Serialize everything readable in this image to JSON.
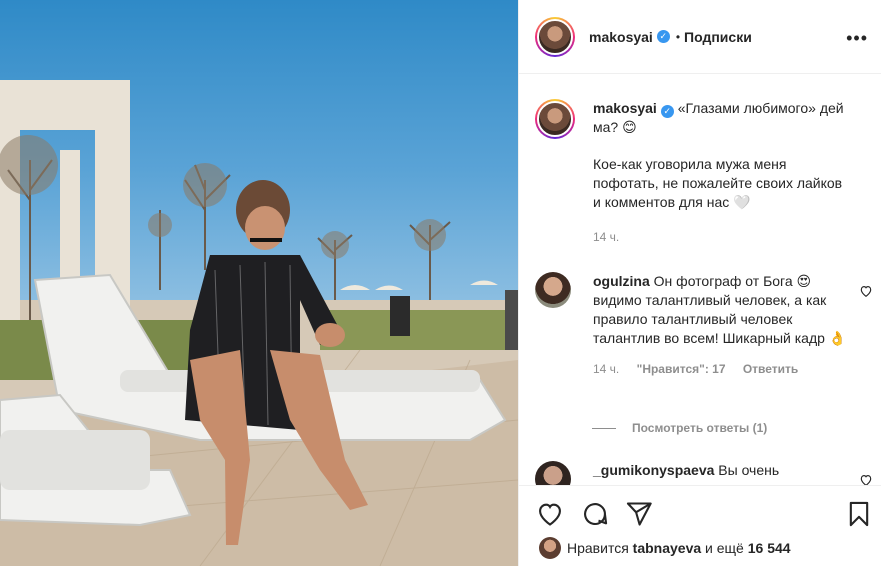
{
  "post": {
    "author": "makosyai",
    "verified_glyph": "✓",
    "follow_separator": "•",
    "follow_label": "Подписки",
    "more_icon": "•••"
  },
  "caption": {
    "author": "makosyai",
    "line1": "«Глазами любимого» дей ма? 😊",
    "line2": "Кое-как уговорила мужа меня пофотать, не пожалейте своих лайков и комментов для нас 🤍",
    "time": "14 ч."
  },
  "comments": [
    {
      "author": "ogulzina",
      "text": "Он фотограф от Бога 😍 видимо талантливый человек, а как правило талантливый человек талантлив во всем! Шикарный кадр 👌",
      "time": "14 ч.",
      "likes": "\"Нравится\": 17",
      "reply": "Ответить"
    },
    {
      "author": "_gumikonyspaeva",
      "text": "Вы очень"
    }
  ],
  "view_replies": "Посмотреть ответы (1)",
  "likes_line": {
    "prefix": "Нравится",
    "user": "tabnayeva",
    "middle": "и ещё",
    "count": "16 544"
  },
  "icons": [
    "heart-icon",
    "comment-icon",
    "share-icon",
    "bookmark-icon"
  ],
  "colors": {
    "verified": "#3897f0",
    "meta": "#8e8e8e",
    "text": "#262626"
  }
}
